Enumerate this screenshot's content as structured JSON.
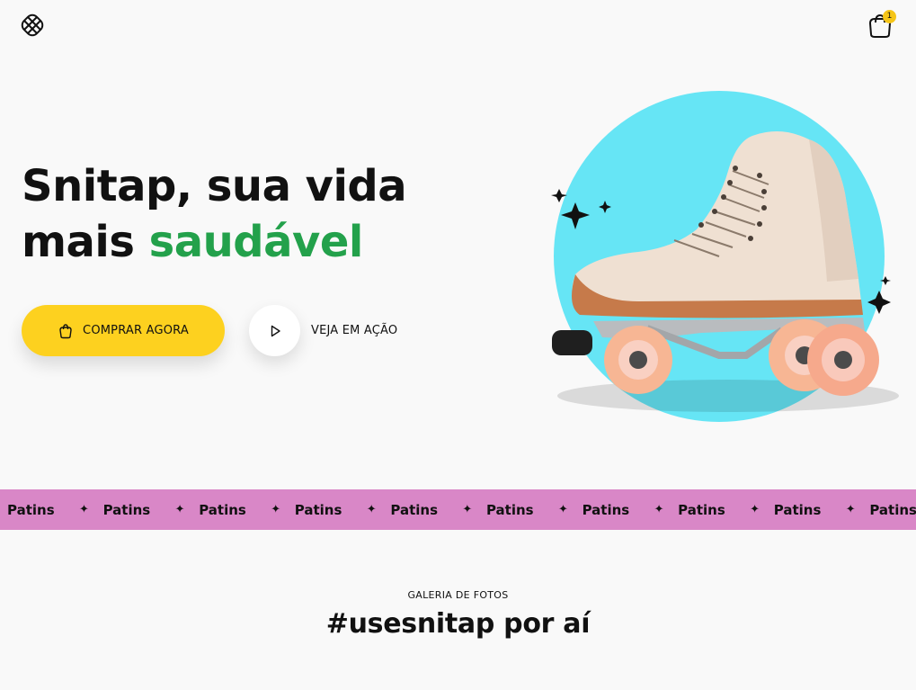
{
  "header": {
    "logo_icon": "snitap-logo-icon",
    "cart_icon": "shopping-bag-icon",
    "cart_count": "1"
  },
  "hero": {
    "title_line1": "Snitap, sua vida",
    "title_line2_prefix": "mais ",
    "title_line2_accent": "saudável",
    "buy_label": "COMPRAR AGORA",
    "buy_icon": "shopping-bag-icon",
    "watch_label": "VEJA EM AÇÃO",
    "watch_icon": "play-icon"
  },
  "marquee": {
    "items": [
      "Patins",
      "Patins",
      "Patins",
      "Patins",
      "Patins",
      "Patins",
      "Patins",
      "Patins",
      "Patins",
      "Patins"
    ],
    "separator_icon": "sparkle-icon"
  },
  "gallery": {
    "eyebrow": "GALERIA DE FOTOS",
    "title": "#usesnitap por aí"
  },
  "colors": {
    "accent_green": "#23a14b",
    "button_yellow": "#fdd11f",
    "marquee_pink": "#d987c7",
    "circle_cyan": "#66e5f5"
  }
}
